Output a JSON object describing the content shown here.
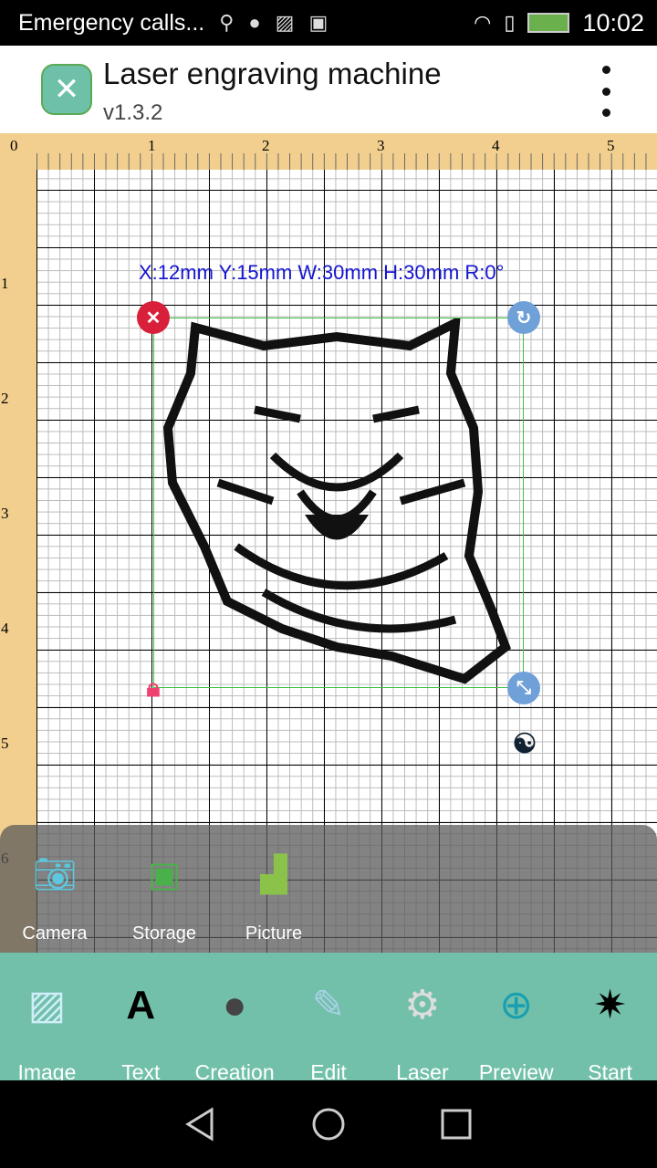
{
  "status": {
    "text": "Emergency calls...",
    "time": "10:02",
    "icons": [
      "usb-icon",
      "android-icon",
      "image-icon",
      "download-icon",
      "wifi-icon",
      "sim-icon",
      "battery-charging-icon"
    ]
  },
  "appbar": {
    "title": "Laser engraving machine",
    "version": "v1.3.2",
    "menu_icon": "more-vert-icon"
  },
  "ruler": {
    "x": [
      "0",
      "1",
      "2",
      "3",
      "4",
      "5"
    ],
    "y": [
      "1",
      "2",
      "3",
      "4",
      "5",
      "6"
    ]
  },
  "selection": {
    "info": "X:12mm  Y:15mm  W:30mm  H:30mm  R:0°",
    "image": "tiger-head"
  },
  "drawer": {
    "items": [
      {
        "label": "Camera",
        "icon": "camera-icon"
      },
      {
        "label": "Storage",
        "icon": "gallery-icon"
      },
      {
        "label": "Picture",
        "icon": "picture-icon"
      }
    ]
  },
  "toolbar": {
    "items": [
      {
        "label": "Image",
        "icon": "image-icon"
      },
      {
        "label": "Text",
        "icon": "text-icon"
      },
      {
        "label": "Creation",
        "icon": "circle-icon"
      },
      {
        "label": "Edit",
        "icon": "edit-image-icon"
      },
      {
        "label": "Laser",
        "icon": "gear-icon"
      },
      {
        "label": "Preview",
        "icon": "crosshair-icon"
      },
      {
        "label": "Start",
        "icon": "laser-icon"
      }
    ]
  },
  "colors": {
    "toolbar": "#72c0aa",
    "ruler": "#f2cf8e",
    "info": "#1515d0",
    "selection": "#40c040"
  }
}
